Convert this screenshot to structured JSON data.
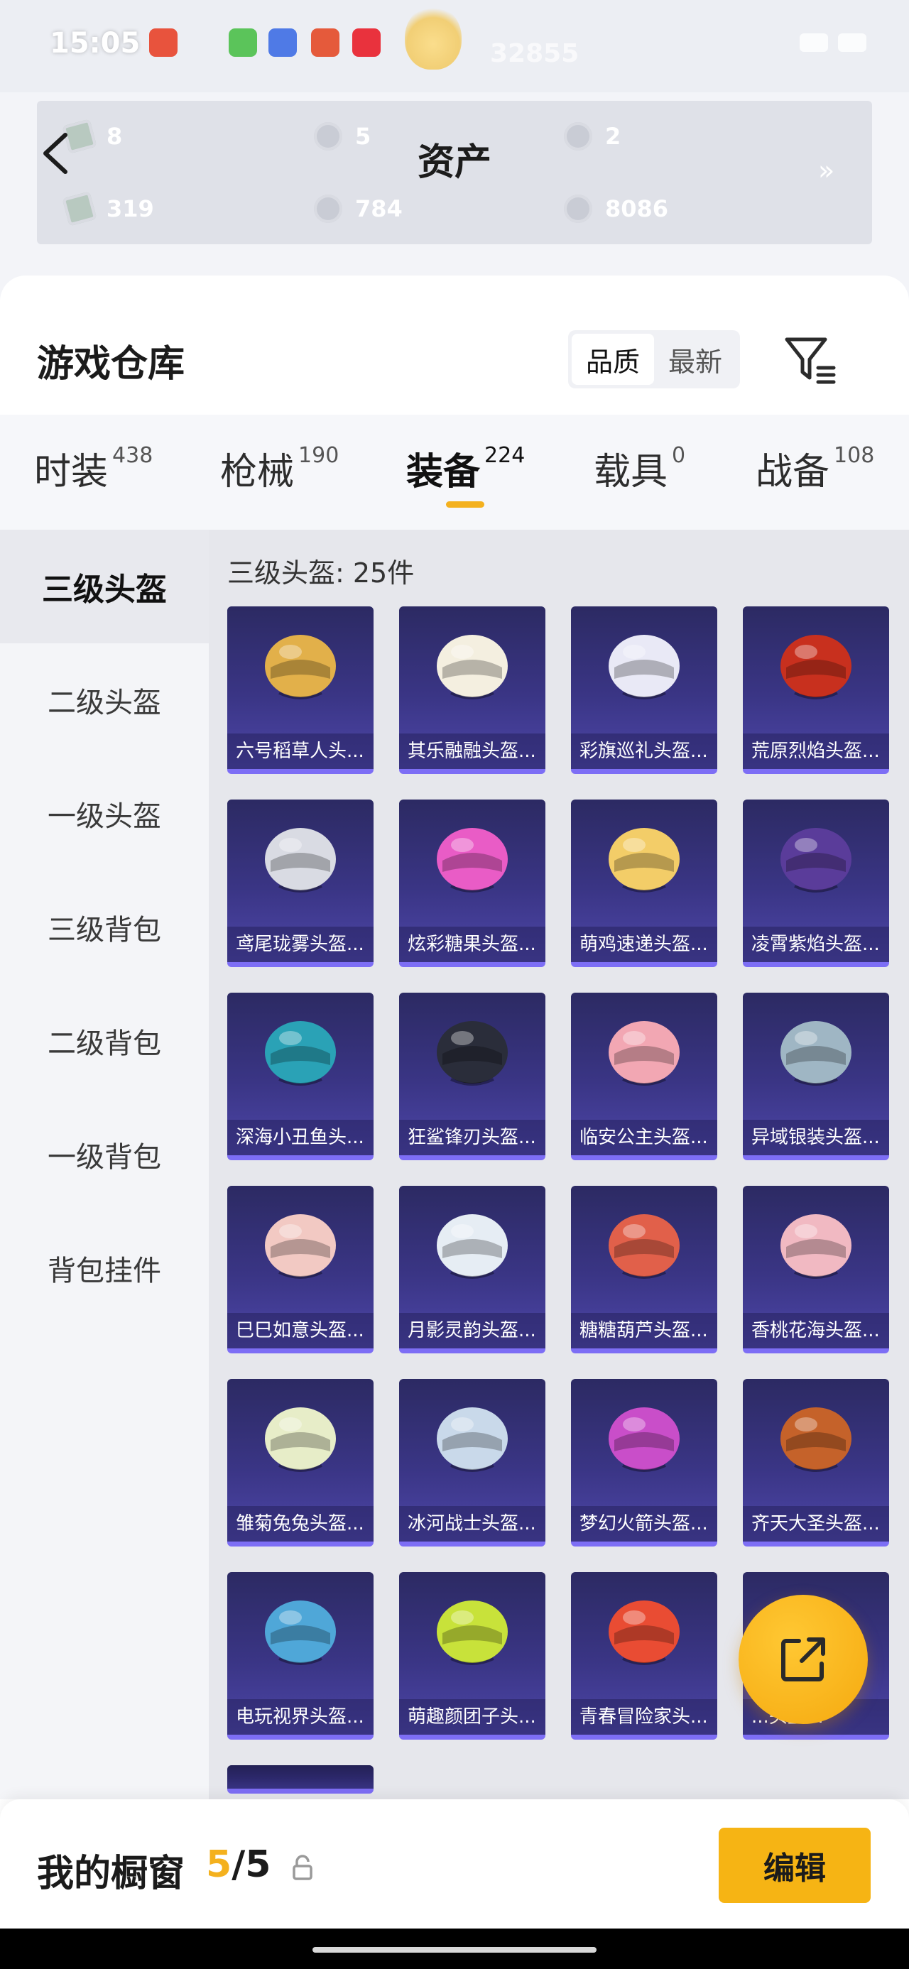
{
  "status_bar": {
    "time": "15:05",
    "blur_number": "32855"
  },
  "header": {
    "title": "资产",
    "more_arrows": "»",
    "assets": [
      "8",
      "5",
      "2",
      "319",
      "784",
      "8086"
    ]
  },
  "warehouse": {
    "title": "游戏仓库",
    "sort": {
      "quality": "品质",
      "latest": "最新"
    }
  },
  "tabs": [
    {
      "label": "时装",
      "count": "438"
    },
    {
      "label": "枪械",
      "count": "190"
    },
    {
      "label": "装备",
      "count": "224"
    },
    {
      "label": "载具",
      "count": "0"
    },
    {
      "label": "战备",
      "count": "108"
    }
  ],
  "side_nav": [
    "三级头盔",
    "二级头盔",
    "一级头盔",
    "三级背包",
    "二级背包",
    "一级背包",
    "背包挂件"
  ],
  "grid": {
    "heading": "三级头盔: 25件",
    "items": [
      {
        "name": "六号稻草人头...",
        "icon": "scarecrow-helmet-icon",
        "color": "#e2b04a"
      },
      {
        "name": "其乐融融头盔...",
        "icon": "white-gold-helmet-icon",
        "color": "#f4efe0"
      },
      {
        "name": "彩旗巡礼头盔...",
        "icon": "parade-helmet-icon",
        "color": "#e9e9f6"
      },
      {
        "name": "荒原烈焰头盔...",
        "icon": "flame-helmet-icon",
        "color": "#c8301e"
      },
      {
        "name": "鸢尾珑雾头盔...",
        "icon": "iris-helmet-icon",
        "color": "#d9dbe3"
      },
      {
        "name": "炫彩糖果头盔...",
        "icon": "candy-helmet-icon",
        "color": "#e95cc6"
      },
      {
        "name": "萌鸡速递头盔...",
        "icon": "chick-helmet-icon",
        "color": "#f3cd68"
      },
      {
        "name": "凌霄紫焰头盔...",
        "icon": "purple-flame-helmet-icon",
        "color": "#5a3c9a"
      },
      {
        "name": "深海小丑鱼头...",
        "icon": "clownfish-helmet-icon",
        "color": "#2aa2b6"
      },
      {
        "name": "狂鲨锋刃头盔...",
        "icon": "shark-helmet-icon",
        "color": "#2a2d3a"
      },
      {
        "name": "临安公主头盔...",
        "icon": "princess-helmet-icon",
        "color": "#f2a7b3"
      },
      {
        "name": "异域银装头盔...",
        "icon": "silver-helmet-icon",
        "color": "#9fb6c4"
      },
      {
        "name": "巳巳如意头盔...",
        "icon": "snake-helmet-icon",
        "color": "#f2c9c3"
      },
      {
        "name": "月影灵韵头盔...",
        "icon": "moon-helmet-icon",
        "color": "#e6edf4"
      },
      {
        "name": "糖糖葫芦头盔...",
        "icon": "gourd-helmet-icon",
        "color": "#e1604a"
      },
      {
        "name": "香桃花海头盔...",
        "icon": "peach-helmet-icon",
        "color": "#f1b9c2"
      },
      {
        "name": "雏菊兔兔头盔...",
        "icon": "bunny-helmet-icon",
        "color": "#e7edc8"
      },
      {
        "name": "冰河战士头盔...",
        "icon": "glacier-helmet-icon",
        "color": "#c9d9ea"
      },
      {
        "name": "梦幻火箭头盔...",
        "icon": "rocket-helmet-icon",
        "color": "#c94ec9"
      },
      {
        "name": "齐天大圣头盔...",
        "icon": "monkey-king-helmet-icon",
        "color": "#c5622a"
      },
      {
        "name": "电玩视界头盔...",
        "icon": "gamer-helmet-icon",
        "color": "#4fa7d8"
      },
      {
        "name": "萌趣颜团子头...",
        "icon": "dumpling-helmet-icon",
        "color": "#c8e23a"
      },
      {
        "name": "青春冒险家头...",
        "icon": "adventure-helmet-icon",
        "color": "#e94c33"
      },
      {
        "name": "...头盔...",
        "icon": "purple-helmet-icon",
        "color": "#9a6be0"
      },
      {
        "name": "",
        "icon": "partial-helmet-icon",
        "color": "#b9bdd0"
      }
    ]
  },
  "bottom_bar": {
    "label": "我的橱窗",
    "current": "5",
    "slash": "/",
    "total": "5",
    "edit": "编辑"
  },
  "colors": {
    "accent": "#f4b11e",
    "card_top": "#2c2a63",
    "card_bottom": "#4d46a8"
  }
}
